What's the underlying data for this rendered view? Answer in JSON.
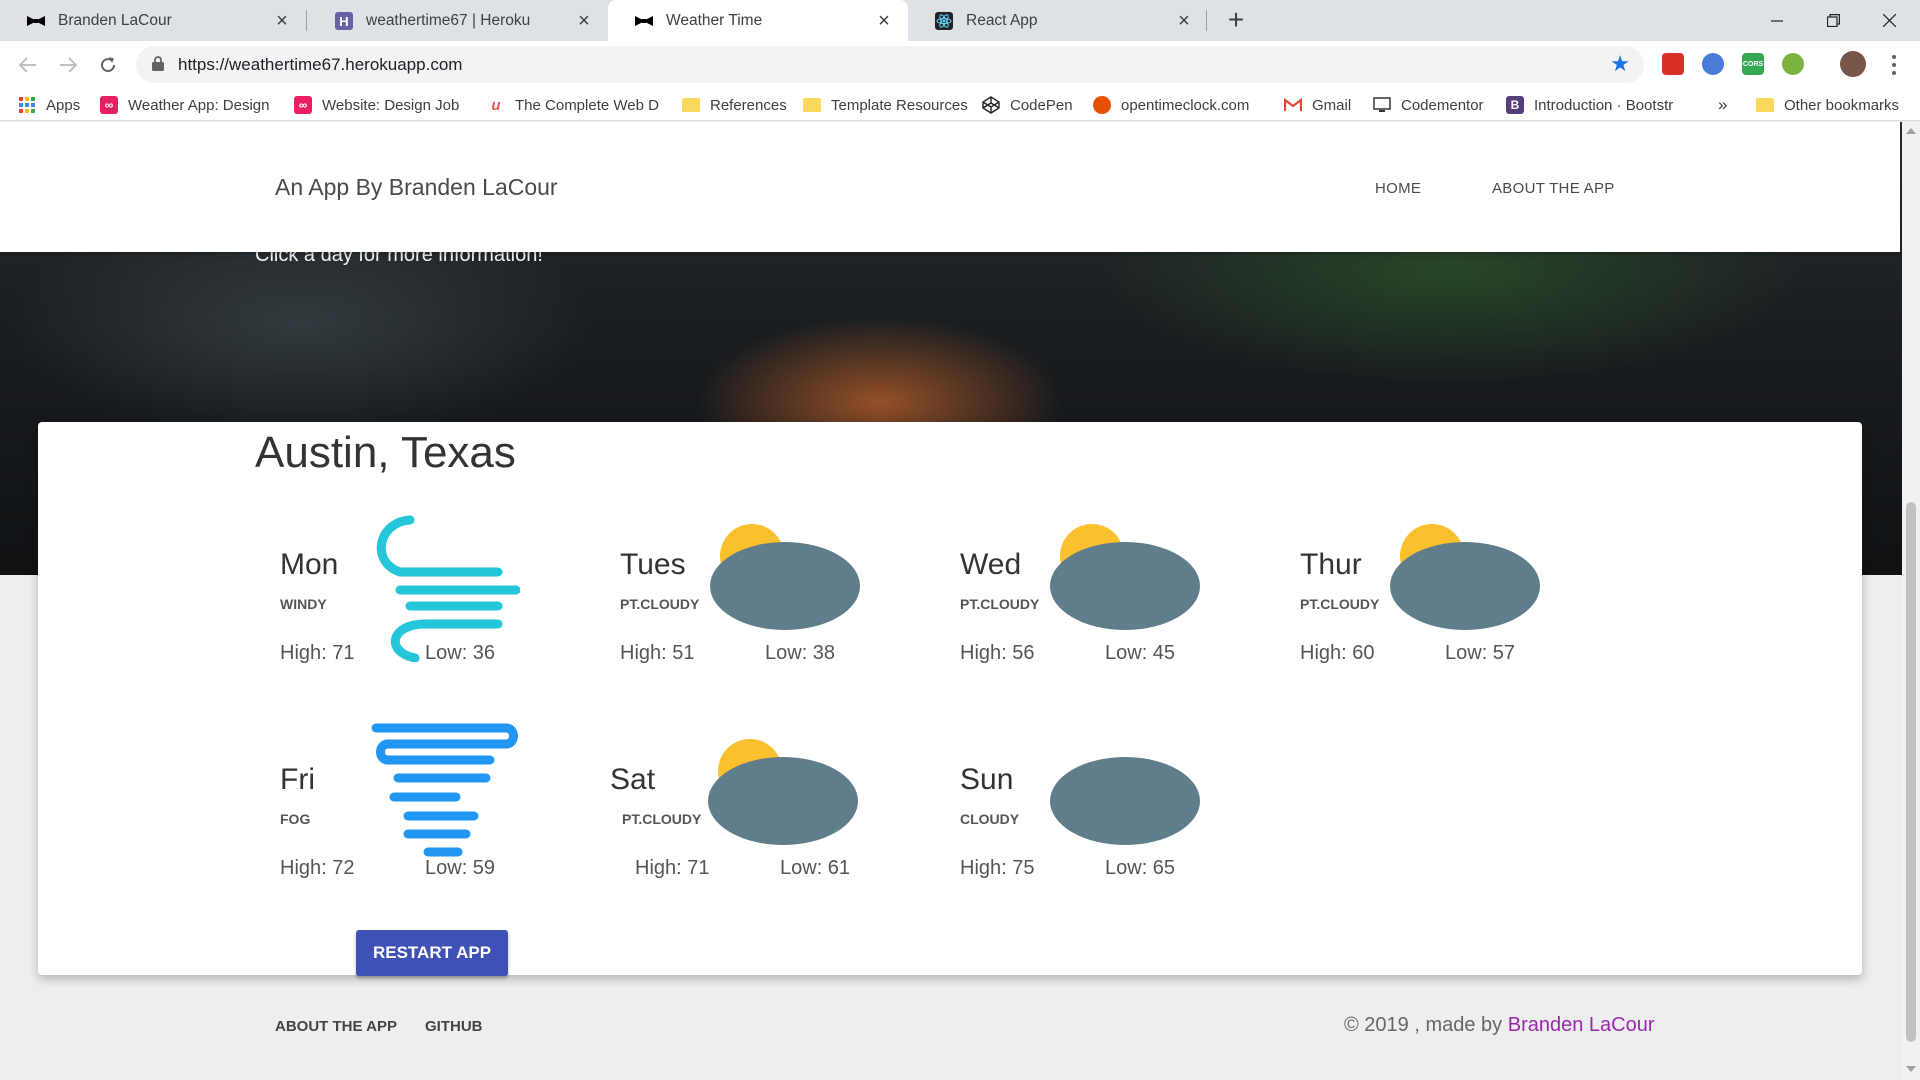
{
  "browser": {
    "tabs": [
      {
        "title": "Branden LaCour",
        "favicon": "bow-tie-icon",
        "active": false
      },
      {
        "title": "weathertime67 | Heroku",
        "favicon": "heroku-icon",
        "active": false
      },
      {
        "title": "Weather Time",
        "favicon": "bow-tie-icon",
        "active": true
      },
      {
        "title": "React App",
        "favicon": "react-icon",
        "active": false
      }
    ],
    "url": "https://weathertime67.herokuapp.com",
    "bookmarks": [
      {
        "label": "Apps",
        "icon": "apps-grid-icon"
      },
      {
        "label": "Weather App: Design",
        "icon": "infinity-icon"
      },
      {
        "label": "Website: Design Job",
        "icon": "infinity-icon"
      },
      {
        "label": "The Complete Web D",
        "icon": "udemy-icon"
      },
      {
        "label": "References",
        "icon": "folder-icon"
      },
      {
        "label": "Template Resources",
        "icon": "folder-icon"
      },
      {
        "label": "CodePen",
        "icon": "codepen-icon"
      },
      {
        "label": "opentimeclock.com",
        "icon": "clock-icon"
      },
      {
        "label": "Gmail",
        "icon": "gmail-icon"
      },
      {
        "label": "Codementor",
        "icon": "codementor-icon"
      },
      {
        "label": "Introduction · Bootstr",
        "icon": "bootstrap-icon"
      }
    ],
    "bookmarks_overflow": "»",
    "other_bookmarks": "Other bookmarks"
  },
  "header": {
    "brand": "An App By Branden LaCour",
    "nav": [
      "HOME",
      "ABOUT THE APP"
    ]
  },
  "hero": {
    "text": "Click a day for more information!"
  },
  "forecast": {
    "city": "Austin, Texas",
    "days": [
      {
        "day": "Mon",
        "condition": "WINDY",
        "high": "High: 71",
        "low": "Low: 36",
        "icon": "wind-icon"
      },
      {
        "day": "Tues",
        "condition": "PT.CLOUDY",
        "high": "High: 51",
        "low": "Low: 38",
        "icon": "partly-cloudy-icon"
      },
      {
        "day": "Wed",
        "condition": "PT.CLOUDY",
        "high": "High: 56",
        "low": "Low: 45",
        "icon": "partly-cloudy-icon"
      },
      {
        "day": "Thur",
        "condition": "PT.CLOUDY",
        "high": "High: 60",
        "low": "Low: 57",
        "icon": "partly-cloudy-icon"
      },
      {
        "day": "Fri",
        "condition": "FOG",
        "high": "High: 72",
        "low": "Low: 59",
        "icon": "fog-icon"
      },
      {
        "day": "Sat",
        "condition": "PT.CLOUDY",
        "high": "High: 71",
        "low": "Low: 61",
        "icon": "partly-cloudy-icon"
      },
      {
        "day": "Sun",
        "condition": "CLOUDY",
        "high": "High: 75",
        "low": "Low: 65",
        "icon": "cloudy-icon"
      }
    ],
    "restart_label": "RESTART APP"
  },
  "footer": {
    "links": [
      "ABOUT THE APP",
      "GITHUB"
    ],
    "copyright_prefix": "© 2019 , made by",
    "author": "Branden LaCour"
  },
  "colors": {
    "accent": "#3f51b5",
    "author_link": "#9c27b0",
    "cloud": "#607d8b",
    "sun": "#fbc02d",
    "wind": "#26c6da",
    "fog": "#2196f3"
  }
}
